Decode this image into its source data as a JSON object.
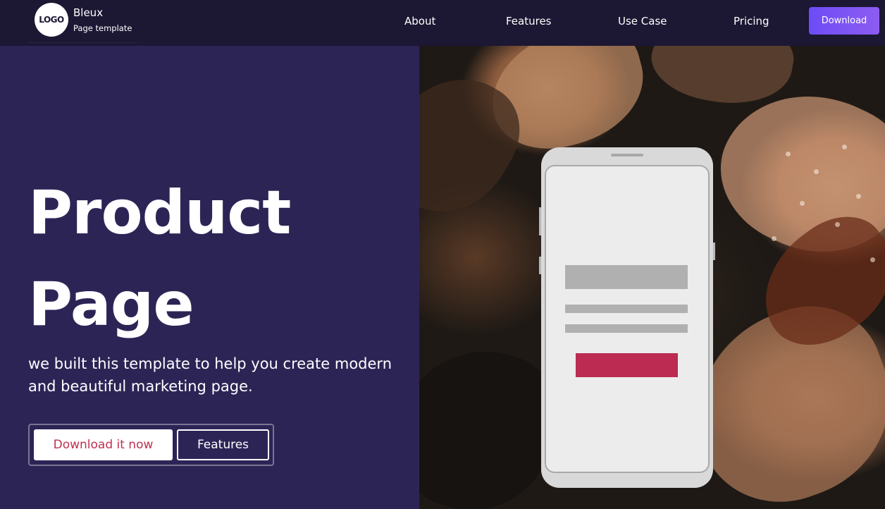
{
  "brand": {
    "logo_text": "LOGO",
    "name": "Bleux",
    "subtitle": "Page template"
  },
  "nav": {
    "links": [
      {
        "label": "About"
      },
      {
        "label": "Features"
      },
      {
        "label": "Use Case"
      },
      {
        "label": "Pricing"
      }
    ],
    "download_label": "Download"
  },
  "hero": {
    "title_line1": "Product",
    "title_line2": "Page",
    "description": "we built this template to help you create modern and beautiful marketing page.",
    "primary_cta": "Download it now",
    "secondary_cta": "Features"
  },
  "colors": {
    "nav_bg": "#1c1733",
    "hero_bg": "#2d2456",
    "accent_purple": "#7b55f4",
    "cta_text": "#c0304f",
    "phone_cta": "#bb2b52"
  }
}
